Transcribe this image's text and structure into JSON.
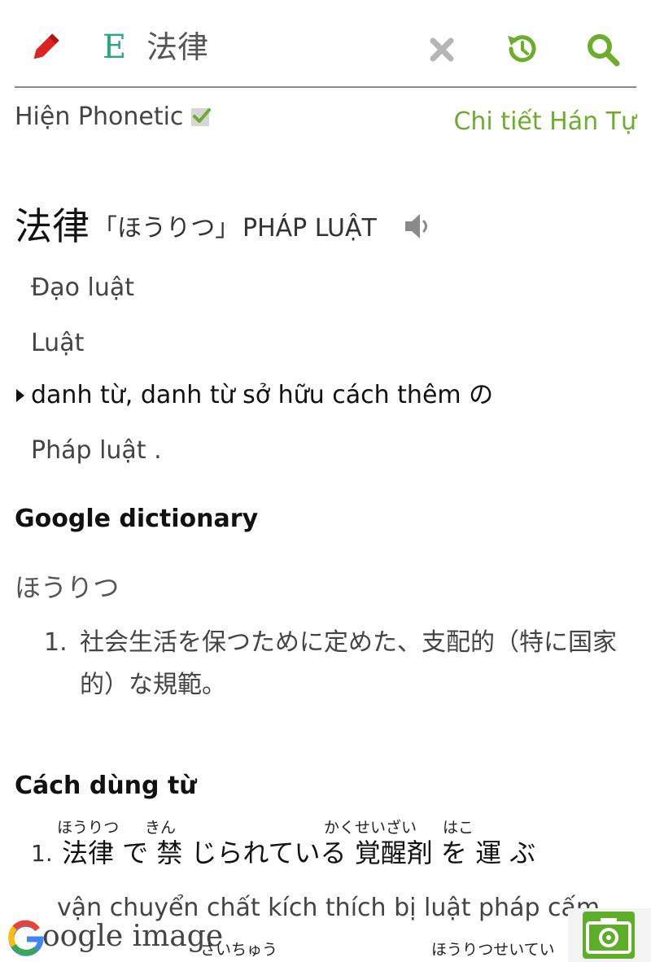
{
  "toolbar": {
    "lang_badge": "E",
    "query": "法律",
    "icons": [
      "pencil-icon",
      "close-icon",
      "history-icon",
      "search-icon"
    ]
  },
  "options": {
    "phonetic_label": "Hiện Phonetic",
    "phonetic_checked": true,
    "kanji_detail_link": "Chi tiết Hán Tự"
  },
  "entry": {
    "word": "法律",
    "reading": "「ほうりつ」",
    "hanviet": "PHÁP LUẬT",
    "meanings": [
      "Đạo luật",
      "Luật"
    ],
    "part_of_speech": "danh từ, danh từ sở hữu cách thêm の",
    "pos_meaning": "Pháp luật ."
  },
  "google_dictionary": {
    "title": "Google dictionary",
    "reading": "ほうりつ",
    "number": "1.",
    "definition_line1": "社会生活を保つために定めた、支配的（特に国家",
    "definition_line2": "的）な規範。"
  },
  "usage": {
    "title": "Cách dùng từ",
    "number": "1.",
    "ruby": [
      "ほうりつ",
      "きん",
      "かくせいざい",
      "はこ"
    ],
    "sentence": "法律 で 禁 じられている 覚醒剤 を 運 ぶ",
    "translation": "vận chuyển chất kích thích bị luật pháp cấm",
    "next_ruby": [
      "さいちゅう",
      "ほうりつせいてい"
    ]
  },
  "bottom": {
    "google_image_label": "oogle image"
  },
  "colors": {
    "accent_green": "#6cae2c",
    "pencil_red": "#e02020",
    "badge_green": "#2aa876"
  }
}
